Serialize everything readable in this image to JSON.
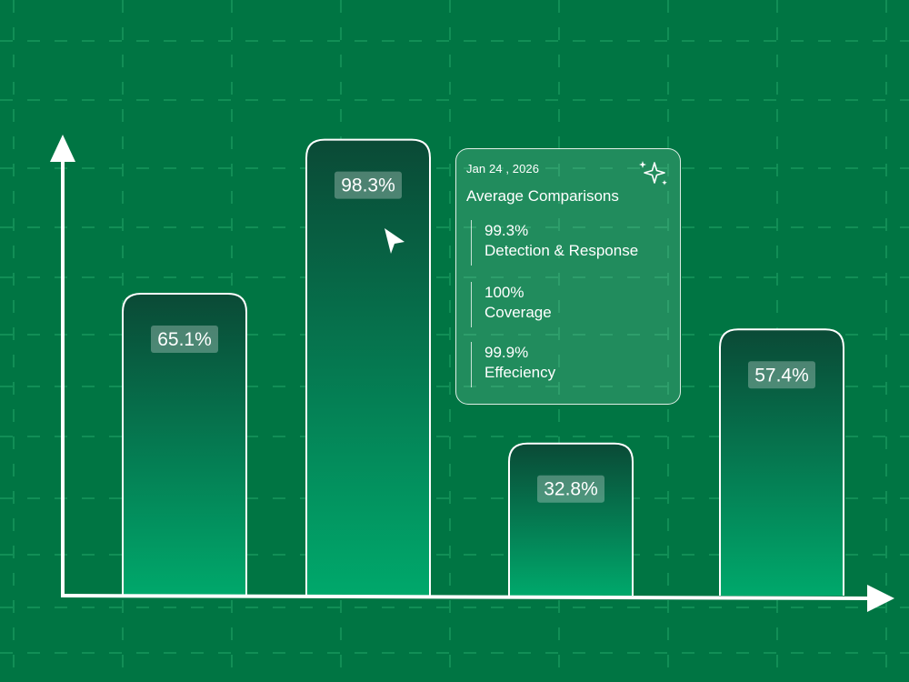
{
  "chart_data": {
    "type": "bar",
    "values": [
      65.1,
      98.3,
      32.8,
      57.4
    ],
    "value_labels": [
      "65.1%",
      "98.3%",
      "32.8%",
      "57.4%"
    ],
    "ylim": [
      0,
      100
    ],
    "grid": true
  },
  "tooltip": {
    "date": "Jan 24 , 2026",
    "title": "Average Comparisons",
    "metrics": [
      {
        "value": "99.3%",
        "label": "Detection & Response"
      },
      {
        "value": "100%",
        "label": "Coverage"
      },
      {
        "value": "99.9%",
        "label": "Effeciency"
      }
    ],
    "icon": "sparkle-icon"
  },
  "colors": {
    "background": "#007543",
    "bar_top": "#0a4a36",
    "bar_bottom": "#00a86b",
    "grid_line": "#2fb978",
    "axis": "#ffffff"
  },
  "pointer_icon": "cursor-arrow-icon"
}
